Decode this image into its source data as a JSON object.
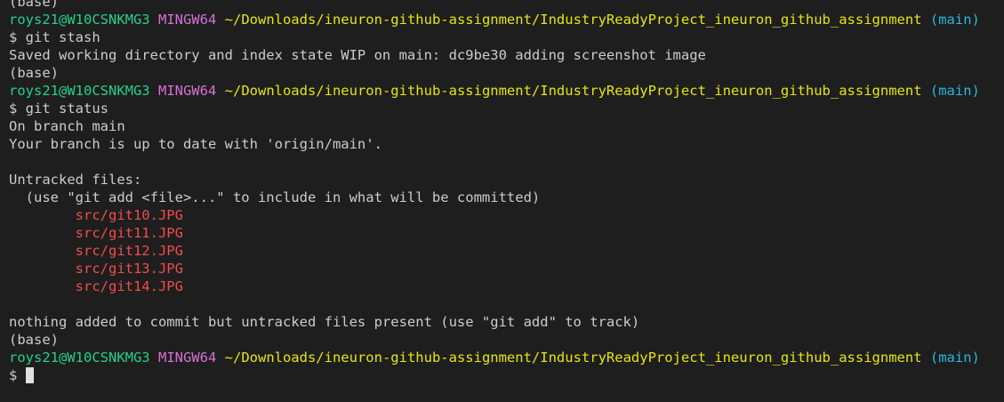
{
  "lines": [
    {
      "type": "plain",
      "text": "(base)"
    },
    {
      "type": "prompt",
      "user": "roys21@W10CSNKMG3",
      "sys": "MINGW64",
      "path": "~/Downloads/ineuron-github-assignment/IndustryReadyProject_ineuron_github_assignment",
      "branch": "(main)"
    },
    {
      "type": "plain",
      "text": "$ git stash"
    },
    {
      "type": "plain",
      "text": "Saved working directory and index state WIP on main: dc9be30 adding screenshot image"
    },
    {
      "type": "plain",
      "text": "(base)"
    },
    {
      "type": "prompt",
      "user": "roys21@W10CSNKMG3",
      "sys": "MINGW64",
      "path": "~/Downloads/ineuron-github-assignment/IndustryReadyProject_ineuron_github_assignment",
      "branch": "(main)"
    },
    {
      "type": "plain",
      "text": "$ git status"
    },
    {
      "type": "plain",
      "text": "On branch main"
    },
    {
      "type": "plain",
      "text": "Your branch is up to date with 'origin/main'."
    },
    {
      "type": "plain",
      "text": ""
    },
    {
      "type": "plain",
      "text": "Untracked files:"
    },
    {
      "type": "plain",
      "text": "  (use \"git add <file>...\" to include in what will be committed)"
    },
    {
      "type": "untracked",
      "text": "        src/git10.JPG"
    },
    {
      "type": "untracked",
      "text": "        src/git11.JPG"
    },
    {
      "type": "untracked",
      "text": "        src/git12.JPG"
    },
    {
      "type": "untracked",
      "text": "        src/git13.JPG"
    },
    {
      "type": "untracked",
      "text": "        src/git14.JPG"
    },
    {
      "type": "plain",
      "text": ""
    },
    {
      "type": "plain",
      "text": "nothing added to commit but untracked files present (use \"git add\" to track)"
    },
    {
      "type": "plain",
      "text": "(base)"
    },
    {
      "type": "prompt",
      "user": "roys21@W10CSNKMG3",
      "sys": "MINGW64",
      "path": "~/Downloads/ineuron-github-assignment/IndustryReadyProject_ineuron_github_assignment",
      "branch": "(main)"
    },
    {
      "type": "input",
      "text": "$ "
    }
  ],
  "colors": {
    "background": "#1e1e1e",
    "foreground": "#cccccc",
    "user": "#23d18b",
    "system": "#d670d6",
    "path": "#e5e510",
    "branch": "#29b8db",
    "untracked": "#f14c4c",
    "cursor": "#e0e0e0"
  }
}
